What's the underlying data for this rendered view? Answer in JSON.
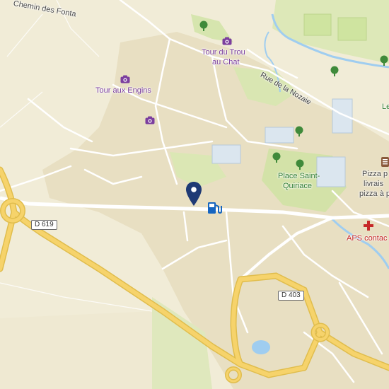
{
  "map": {
    "colors": {
      "land": "#f1ecd7",
      "urban": "#e9e1c6",
      "park": "#d8e6b0",
      "water": "#9fcdf0",
      "major_road": "#f6d36b",
      "road": "#ffffff",
      "pin": "#1f3a75",
      "fuel": "#1565c0"
    },
    "labels": {
      "chemin": "Chemin des Fonta",
      "tour_trou_1": "Tour du Trou",
      "tour_trou_2": "au Chat",
      "tour_engins": "Tour aux Engins",
      "rue_nozaie": "Rue de la Nozaie",
      "place_1": "Place Saint-",
      "place_2": "Quiriace",
      "pizza_1": "Pizza p",
      "pizza_2": "livrais",
      "pizza_3": "pizza à p",
      "aps": "APS contac",
      "le": "Le"
    },
    "roads": {
      "d619": "D 619",
      "d403": "D 403"
    },
    "icons": {
      "camera": "camera-icon",
      "tree": "tree-icon",
      "fuel": "fuel-station-icon",
      "pin": "location-pin-icon",
      "cross": "pharmacy-cross-icon",
      "restaurant": "restaurant-icon"
    }
  }
}
